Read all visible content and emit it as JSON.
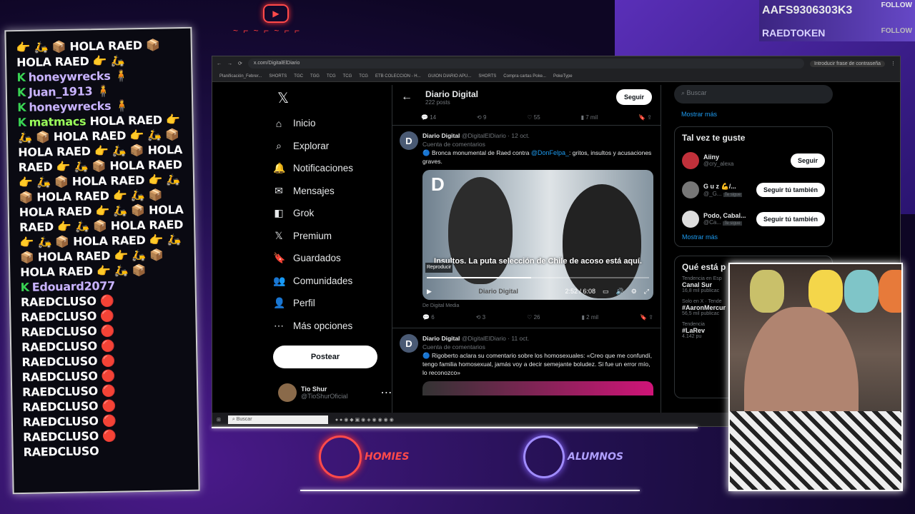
{
  "overlay": {
    "handle": "AAFS9306303K3",
    "follow": "FOLLOW",
    "token": "RAEDTOKEN",
    "follow2": "FOLLOW",
    "homies": "HOMIES",
    "alumnos": "ALUMNOS"
  },
  "chat": [
    {
      "user": "",
      "text": "👉 🛵 📦 HOLA RAED 📦 HOLA RAED 👉 🛵"
    },
    {
      "user": "honeywrecks",
      "text": "🧍"
    },
    {
      "user": "Juan_1913",
      "text": "🧍"
    },
    {
      "user": "honeywrecks",
      "text": "🧍"
    },
    {
      "user": "matmacs",
      "text": "HOLA RAED 👉 🛵 📦 HOLA RAED 👉 🛵 📦 HOLA RAED 👉 🛵 📦 HOLA RAED 👉 🛵 📦 HOLA RAED 👉 🛵 📦 HOLA RAED 👉 🛵 📦 HOLA RAED 👉 🛵 📦 HOLA RAED 👉 🛵 📦 HOLA RAED 👉 🛵 📦 HOLA RAED 👉 🛵 📦 HOLA RAED 👉 🛵 📦 HOLA RAED 👉 🛵 📦 HOLA RAED 👉 🛵 📦"
    },
    {
      "user": "Edouard2077",
      "text": "RAEDCLUSO 🔴 RAEDCLUSO 🔴 RAEDCLUSO 🔴 RAEDCLUSO 🔴 RAEDCLUSO 🔴 RAEDCLUSO 🔴 RAEDCLUSO 🔴 RAEDCLUSO 🔴 RAEDCLUSO 🔴 RAEDCLUSO 🔴 RAEDCLUSO"
    }
  ],
  "browser": {
    "url": "x.com/DigitalElDiario",
    "password_hint": "Introducir frase de contraseña",
    "bookmarks": [
      "Planificación_Febrer...",
      "SHORTS",
      "TGC",
      "TGG",
      "TCG",
      "TCG",
      "TCG",
      "ETB COLECCION - H...",
      "GUION DIARIO APU...",
      "SHORTS",
      "Compra cartas Poke...",
      "PokeType"
    ]
  },
  "nav": {
    "logo": "𝕏",
    "items": [
      {
        "icon": "⌂",
        "label": "Inicio"
      },
      {
        "icon": "⌕",
        "label": "Explorar"
      },
      {
        "icon": "🔔",
        "label": "Notificaciones"
      },
      {
        "icon": "✉",
        "label": "Mensajes"
      },
      {
        "icon": "◧",
        "label": "Grok"
      },
      {
        "icon": "𝕏",
        "label": "Premium"
      },
      {
        "icon": "🔖",
        "label": "Guardados"
      },
      {
        "icon": "👥",
        "label": "Comunidades"
      },
      {
        "icon": "👤",
        "label": "Perfil"
      },
      {
        "icon": "⋯",
        "label": "Más opciones"
      }
    ],
    "post": "Postear",
    "user_name": "Tio Shur",
    "user_handle": "@TioShurOficial"
  },
  "feed": {
    "title": "Diario Digital",
    "posts_count": "222 posts",
    "follow": "Seguir",
    "top_source": "De Digital Media",
    "top_actions": {
      "replies": "14",
      "reposts": "9",
      "likes": "55",
      "views": "7 mil"
    },
    "tweet1": {
      "name": "Diario Digital",
      "handle": "@DigitalElDiario · 12 oct.",
      "badge": "Cuenta de comentarios",
      "text_a": "🔵 Bronca monumental de Raed contra ",
      "mention": "@DonFelpa_",
      "text_b": ": gritos, insultos y acusaciones graves.",
      "caption": "Insultos. La puta selección de Chile de acoso está aquí.",
      "tooltip": "Reproducir",
      "time": "2:52 / 6:08",
      "watermark": "Diario Digital",
      "source": "De Digital Media",
      "replies": "6",
      "reposts": "3",
      "likes": "26",
      "views": "2 mil"
    },
    "tweet2": {
      "name": "Diario Digital",
      "handle": "@DigitalElDiario · 11 oct.",
      "badge": "Cuenta de comentarios",
      "text": "🔵 Rigoberto aclara su comentario sobre los homosexuales: «Creo que me confundí, tengo familia homosexual, jamás voy a decir semejante boludez. Si fue un error mío, lo reconozco»"
    }
  },
  "right": {
    "search": "Buscar",
    "show_more": "Mostrar más",
    "suggest_title": "Tal vez te guste",
    "suggestions": [
      {
        "name": "Aiiny",
        "handle": "@cry_alexa",
        "btn": "Seguir",
        "tag": ""
      },
      {
        "name": "G u z 💪/...",
        "handle": "@_G...",
        "btn": "Seguir tú también",
        "tag": "Te sigue"
      },
      {
        "name": "Podo, Cabal...",
        "handle": "@Ca...",
        "btn": "Seguir tú también",
        "tag": "Te sigue"
      }
    ],
    "show_more2": "Mostrar más",
    "trends_title": "Qué está p",
    "trends": [
      {
        "ctx": "Tendencia en Esp",
        "name": "Canal Sur",
        "count": "16,8 mil publicac"
      },
      {
        "ctx": "Solo en X · Tende",
        "name": "#AaronMercur",
        "count": "56,5 mil publicac"
      },
      {
        "ctx": "Tendencia",
        "name": "#LaRev",
        "count": "4.142 pu"
      }
    ]
  },
  "taskbar": {
    "search": "Buscar"
  }
}
